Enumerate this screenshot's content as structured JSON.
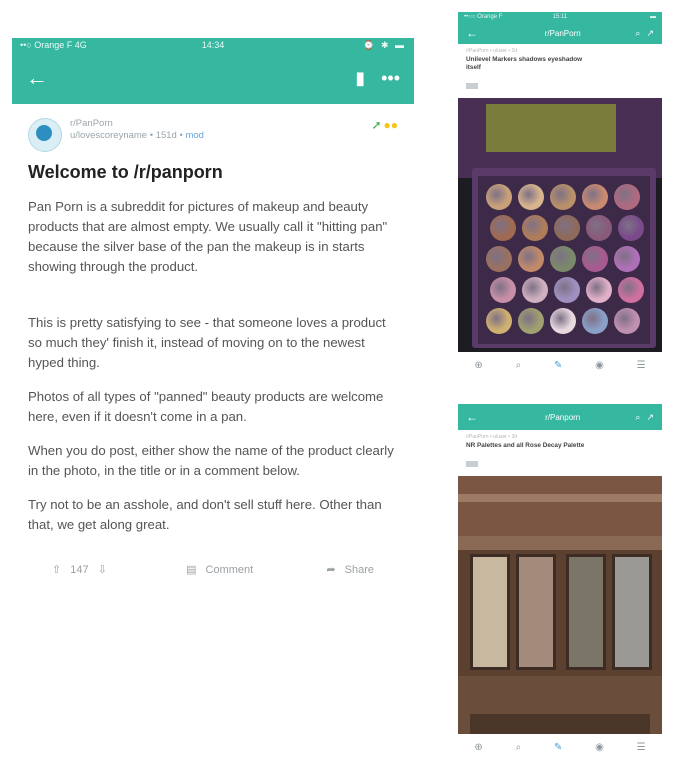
{
  "left": {
    "status": {
      "carrier": "••○ Orange F  4G",
      "time": "14:34",
      "icons": "⌚ ✱ ▬"
    },
    "post": {
      "subreddit": "r/PanPorn",
      "byline": "u/lovescoreyname • 151d •",
      "byline_flair": "mod",
      "title": "Welcome to /r/panporn",
      "paragraphs": [
        "Pan Porn is a subreddit for pictures of makeup and beauty products that are almost empty. We usually call it \"hitting pan\" because the silver base of the pan the makeup is in starts showing through the product.",
        "This is pretty satisfying to see - that someone loves a product so much they' finish it, instead of moving on to the newest hyped thing.",
        "Photos of all types of \"panned\" beauty products are welcome here, even if it doesn't come in a pan.",
        "When you do post, either show the name of the product clearly in the photo, in the title or in a comment below.",
        "Try not to be an asshole, and don't sell stuff here. Other than that, we get along great."
      ],
      "votes": "147",
      "comment_label": "Comment",
      "share_label": "Share"
    }
  },
  "right_top": {
    "status": {
      "carrier": "••○○ Orange F",
      "time": "15:11",
      "battery": "▬"
    },
    "sub": "r/PanPorn",
    "crumb": "r/PanPorn • u/user • 2d",
    "title": "Unilevel Markers shadows eyeshadow",
    "title2": "itself"
  },
  "right_bottom": {
    "sub": "r/Panporn",
    "crumb": "r/PanPorn • u/user • 3d",
    "title": "NR Palettes and all Rose Decay Palette"
  },
  "icons": {
    "back": "←",
    "bookmark": "▮",
    "more": "•••",
    "search": "⌕",
    "share": "↗",
    "upvote": "⇧",
    "downvote": "⇩",
    "comment": "▤",
    "share_action": "➦",
    "tab_home": "⊕",
    "tab_search": "⌕",
    "tab_post": "✎",
    "tab_chat": "◉",
    "tab_inbox": "☰"
  },
  "colors": {
    "header": "#35b7a0",
    "award_gold": "#f5c518",
    "pin_green": "#3aa74a",
    "mod_blue": "#6aa3d8"
  }
}
